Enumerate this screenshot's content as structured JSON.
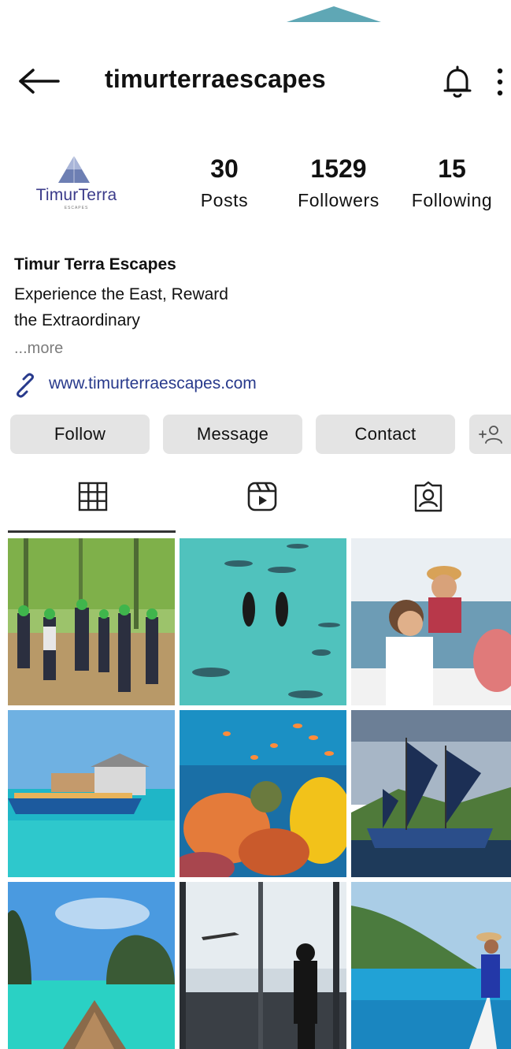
{
  "header": {
    "username": "timurterraescapes"
  },
  "profile": {
    "avatar_wordmark": "TimurTerra",
    "avatar_sub": "ESCAPES",
    "display_name": "Timur Terra Escapes",
    "bio_lines": [
      "Experience the East, Reward",
      "the Extraordinary"
    ],
    "more_label": "...more",
    "website": "www.timurterraescapes.com"
  },
  "stats": [
    {
      "value": "30",
      "label": "Posts"
    },
    {
      "value": "1529",
      "label": "Followers"
    },
    {
      "value": "15",
      "label": "Following"
    }
  ],
  "actions": {
    "follow": "Follow",
    "message": "Message",
    "contact": "Contact"
  },
  "tabs": [
    {
      "icon": "grid-icon"
    },
    {
      "icon": "reels-icon"
    },
    {
      "icon": "tagged-icon"
    }
  ],
  "grid_posts": [
    {
      "subject": "team-building-outdoors"
    },
    {
      "subject": "swimming-with-sharks"
    },
    {
      "subject": "couple-on-boat"
    },
    {
      "subject": "stilt-house-boat"
    },
    {
      "subject": "coral-reef-fish"
    },
    {
      "subject": "phinisi-sailboat"
    },
    {
      "subject": "longtail-boat-islands"
    },
    {
      "subject": "airport-window-plane"
    },
    {
      "subject": "woman-on-boat-bow"
    }
  ],
  "colors": {
    "button_bg": "#e4e4e4",
    "link": "#283a8c",
    "accent_notch": "#5fa7b5"
  }
}
